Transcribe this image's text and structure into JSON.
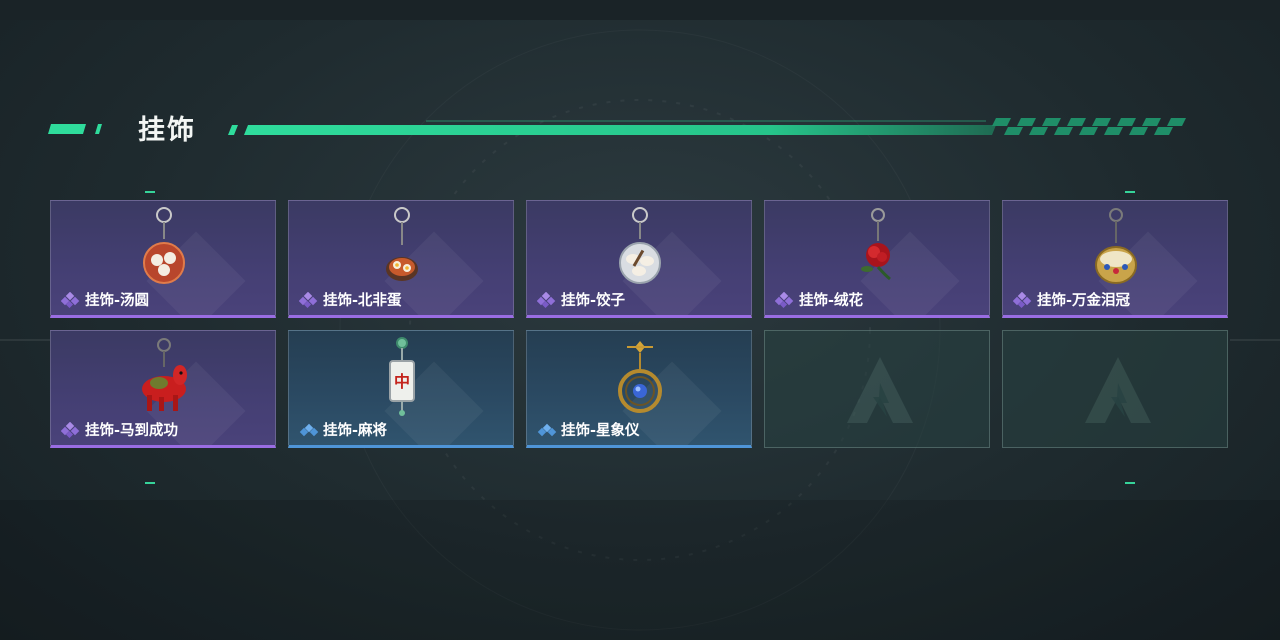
{
  "section": {
    "title": "挂饰"
  },
  "colors": {
    "accent": "#2fdc9c",
    "epic": "#9a6de3",
    "rare": "#4f95d8",
    "empty": "#2a4444"
  },
  "items": [
    {
      "label": "挂饰-汤圆",
      "rarity": "epic",
      "icon": "tangyuan-charm-icon",
      "filled": true
    },
    {
      "label": "挂饰-北非蛋",
      "rarity": "epic",
      "icon": "shakshuka-charm-icon",
      "filled": true
    },
    {
      "label": "挂饰-饺子",
      "rarity": "epic",
      "icon": "dumpling-charm-icon",
      "filled": true
    },
    {
      "label": "挂饰-绒花",
      "rarity": "epic",
      "icon": "velvet-flower-charm-icon",
      "filled": true
    },
    {
      "label": "挂饰-万金泪冠",
      "rarity": "epic",
      "icon": "jeweled-crown-charm-icon",
      "filled": true
    },
    {
      "label": "挂饰-马到成功",
      "rarity": "epic",
      "icon": "red-horse-charm-icon",
      "filled": true
    },
    {
      "label": "挂饰-麻将",
      "rarity": "rare",
      "icon": "mahjong-tile-charm-icon",
      "filled": true
    },
    {
      "label": "挂饰-星象仪",
      "rarity": "rare",
      "icon": "astrolabe-charm-icon",
      "filled": true
    },
    {
      "label": "",
      "rarity": "none",
      "icon": "empty-slot-logo-icon",
      "filled": false
    },
    {
      "label": "",
      "rarity": "none",
      "icon": "empty-slot-logo-icon",
      "filled": false
    }
  ]
}
